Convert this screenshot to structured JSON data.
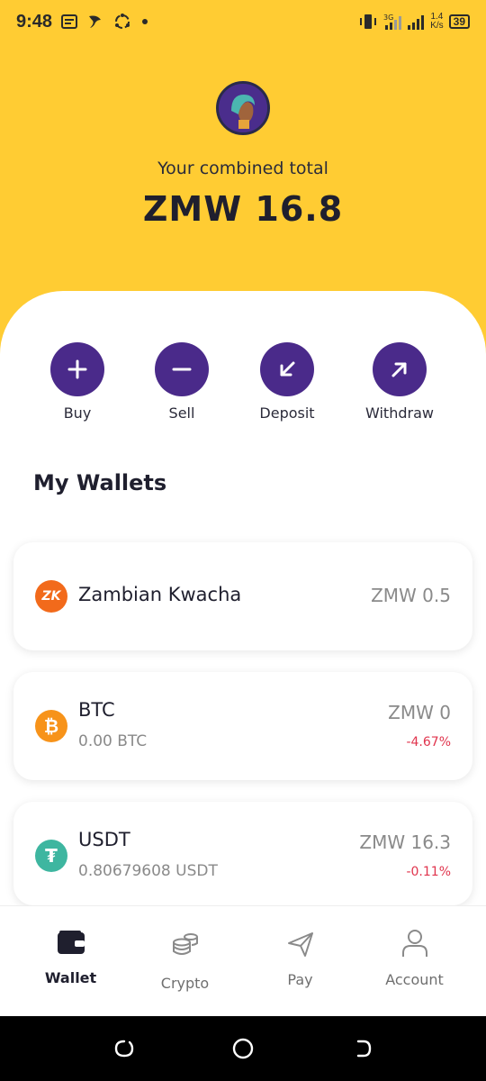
{
  "status_bar": {
    "time": "9:48",
    "net_speed_value": "1.4",
    "net_speed_unit": "K/s",
    "battery": "39",
    "left_icons": [
      "message-icon",
      "app-icon",
      "sync-icon",
      "dot-icon"
    ],
    "right_icons": [
      "vibrate-icon",
      "3g-signal-icon",
      "cell-signal-icon"
    ]
  },
  "header": {
    "total_label": "Your combined total",
    "total_value": "ZMW 16.8"
  },
  "actions": [
    {
      "label": "Buy",
      "icon": "plus-icon"
    },
    {
      "label": "Sell",
      "icon": "minus-icon"
    },
    {
      "label": "Deposit",
      "icon": "arrow-down-left-icon"
    },
    {
      "label": "Withdraw",
      "icon": "arrow-up-right-icon"
    }
  ],
  "wallets_title": "My Wallets",
  "wallets": [
    {
      "name": "Zambian Kwacha",
      "coin_text": "ZK",
      "value": "ZMW 0.5",
      "color": "#F26A1B"
    },
    {
      "name": "BTC",
      "coin_text": "₿",
      "sub": "0.00 BTC",
      "value": "ZMW 0",
      "change": "-4.67%",
      "color": "#F7931A"
    },
    {
      "name": "USDT",
      "coin_text": "₮",
      "sub": "0.80679608 USDT",
      "value": "ZMW 16.3",
      "change": "-0.11%",
      "color": "#3EB6A0"
    }
  ],
  "nav": [
    {
      "label": "Wallet",
      "icon": "wallet-icon",
      "active": true
    },
    {
      "label": "Crypto",
      "icon": "coins-icon",
      "active": false
    },
    {
      "label": "Pay",
      "icon": "send-icon",
      "active": false
    },
    {
      "label": "Account",
      "icon": "user-icon",
      "active": false
    }
  ],
  "colors": {
    "header_bg": "#FFCC33",
    "accent_purple": "#4A2A8A",
    "negative": "#e0344d"
  }
}
